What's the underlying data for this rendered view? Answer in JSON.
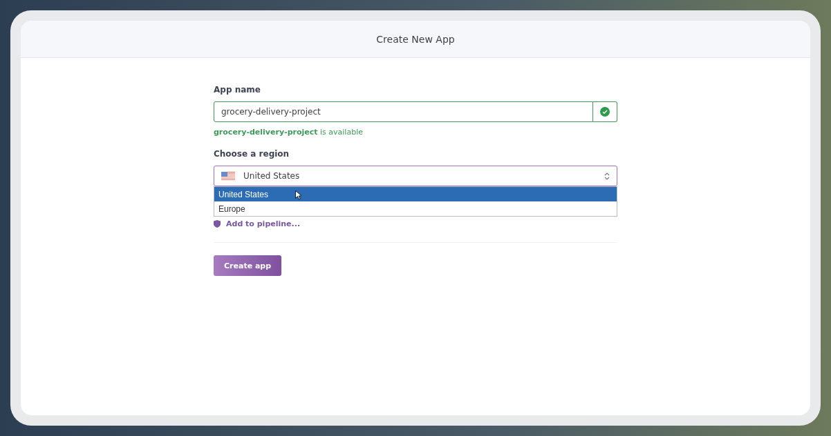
{
  "dialog": {
    "title": "Create New App"
  },
  "app_name": {
    "label": "App name",
    "value": "grocery-delivery-project",
    "valid": true,
    "message": "**grocery-delivery-project** is available"
  },
  "region": {
    "label": "Choose a region",
    "value": "United States",
    "expanded": true,
    "options": [
      {
        "label": "United States",
        "selected": true
      },
      {
        "label": "Europe",
        "selected": false
      }
    ]
  },
  "pipeline_link": "Add to pipeline...",
  "create_button": "Create app"
}
